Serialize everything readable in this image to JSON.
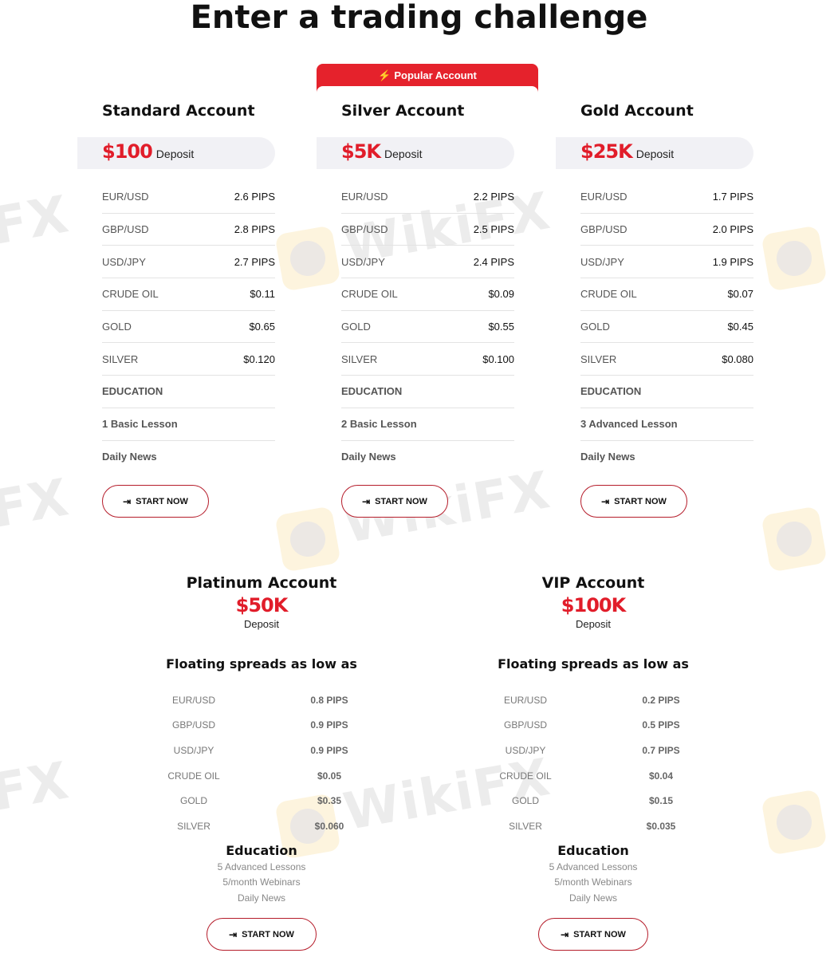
{
  "page": {
    "title": "Enter a trading challenge"
  },
  "colors": {
    "accent": "#e11d2a",
    "badge": "#e5222c",
    "button_border": "#b51c2a"
  },
  "icons": {
    "bolt": "⚡",
    "start": "⇥"
  },
  "popular_badge": {
    "label": "Popular Account",
    "icon": "bolt-icon"
  },
  "top_accounts": [
    {
      "name": "Standard Account",
      "deposit": "$100",
      "deposit_label": "Deposit",
      "rows": [
        {
          "k": "EUR/USD",
          "v": "2.6 PIPS"
        },
        {
          "k": "GBP/USD",
          "v": "2.8 PIPS"
        },
        {
          "k": "USD/JPY",
          "v": "2.7 PIPS"
        },
        {
          "k": "CRUDE OIL",
          "v": "$0.11"
        },
        {
          "k": "GOLD",
          "v": "$0.65"
        },
        {
          "k": "SILVER",
          "v": "$0.120"
        }
      ],
      "education": [
        "EDUCATION",
        "1 Basic Lesson",
        "Daily News"
      ],
      "button": "START NOW"
    },
    {
      "name": "Silver Account",
      "deposit": "$5K",
      "deposit_label": "Deposit",
      "popular": true,
      "rows": [
        {
          "k": "EUR/USD",
          "v": "2.2 PIPS"
        },
        {
          "k": "GBP/USD",
          "v": "2.5 PIPS"
        },
        {
          "k": "USD/JPY",
          "v": "2.4 PIPS"
        },
        {
          "k": "CRUDE OIL",
          "v": "$0.09"
        },
        {
          "k": "GOLD",
          "v": "$0.55"
        },
        {
          "k": "SILVER",
          "v": "$0.100"
        }
      ],
      "education": [
        "EDUCATION",
        "2 Basic Lesson",
        "Daily News"
      ],
      "button": "START NOW"
    },
    {
      "name": "Gold Account",
      "deposit": "$25K",
      "deposit_label": "Deposit",
      "rows": [
        {
          "k": "EUR/USD",
          "v": "1.7 PIPS"
        },
        {
          "k": "GBP/USD",
          "v": "2.0 PIPS"
        },
        {
          "k": "USD/JPY",
          "v": "1.9 PIPS"
        },
        {
          "k": "CRUDE OIL",
          "v": "$0.07"
        },
        {
          "k": "GOLD",
          "v": "$0.45"
        },
        {
          "k": "SILVER",
          "v": "$0.080"
        }
      ],
      "education": [
        "EDUCATION",
        "3 Advanced Lesson",
        "Daily News"
      ],
      "button": "START NOW"
    }
  ],
  "bottom_accounts": [
    {
      "name": "Platinum Account",
      "deposit": "$50K",
      "deposit_label": "Deposit",
      "spreads_title": "Floating spreads as low as",
      "rows": [
        {
          "k": "EUR/USD",
          "v": "0.8 PIPS"
        },
        {
          "k": "GBP/USD",
          "v": "0.9 PIPS"
        },
        {
          "k": "USD/JPY",
          "v": "0.9 PIPS"
        },
        {
          "k": "CRUDE OIL",
          "v": "$0.05"
        },
        {
          "k": "GOLD",
          "v": "$0.35"
        },
        {
          "k": "SILVER",
          "v": "$0.060"
        }
      ],
      "education_title": "Education",
      "education": [
        "5 Advanced Lessons",
        "5/month Webinars",
        "Daily News"
      ],
      "button": "START NOW"
    },
    {
      "name": "VIP Account",
      "deposit": "$100K",
      "deposit_label": "Deposit",
      "spreads_title": "Floating spreads as low as",
      "rows": [
        {
          "k": "EUR/USD",
          "v": "0.2 PIPS"
        },
        {
          "k": "GBP/USD",
          "v": "0.5 PIPS"
        },
        {
          "k": "USD/JPY",
          "v": "0.7 PIPS"
        },
        {
          "k": "CRUDE OIL",
          "v": "$0.04"
        },
        {
          "k": "GOLD",
          "v": "$0.15"
        },
        {
          "k": "SILVER",
          "v": "$0.035"
        }
      ],
      "education_title": "Education",
      "education": [
        "5 Advanced Lessons",
        "5/month Webinars",
        "Daily News"
      ],
      "button": "START NOW"
    }
  ],
  "watermark": {
    "text": "WikiFX"
  }
}
